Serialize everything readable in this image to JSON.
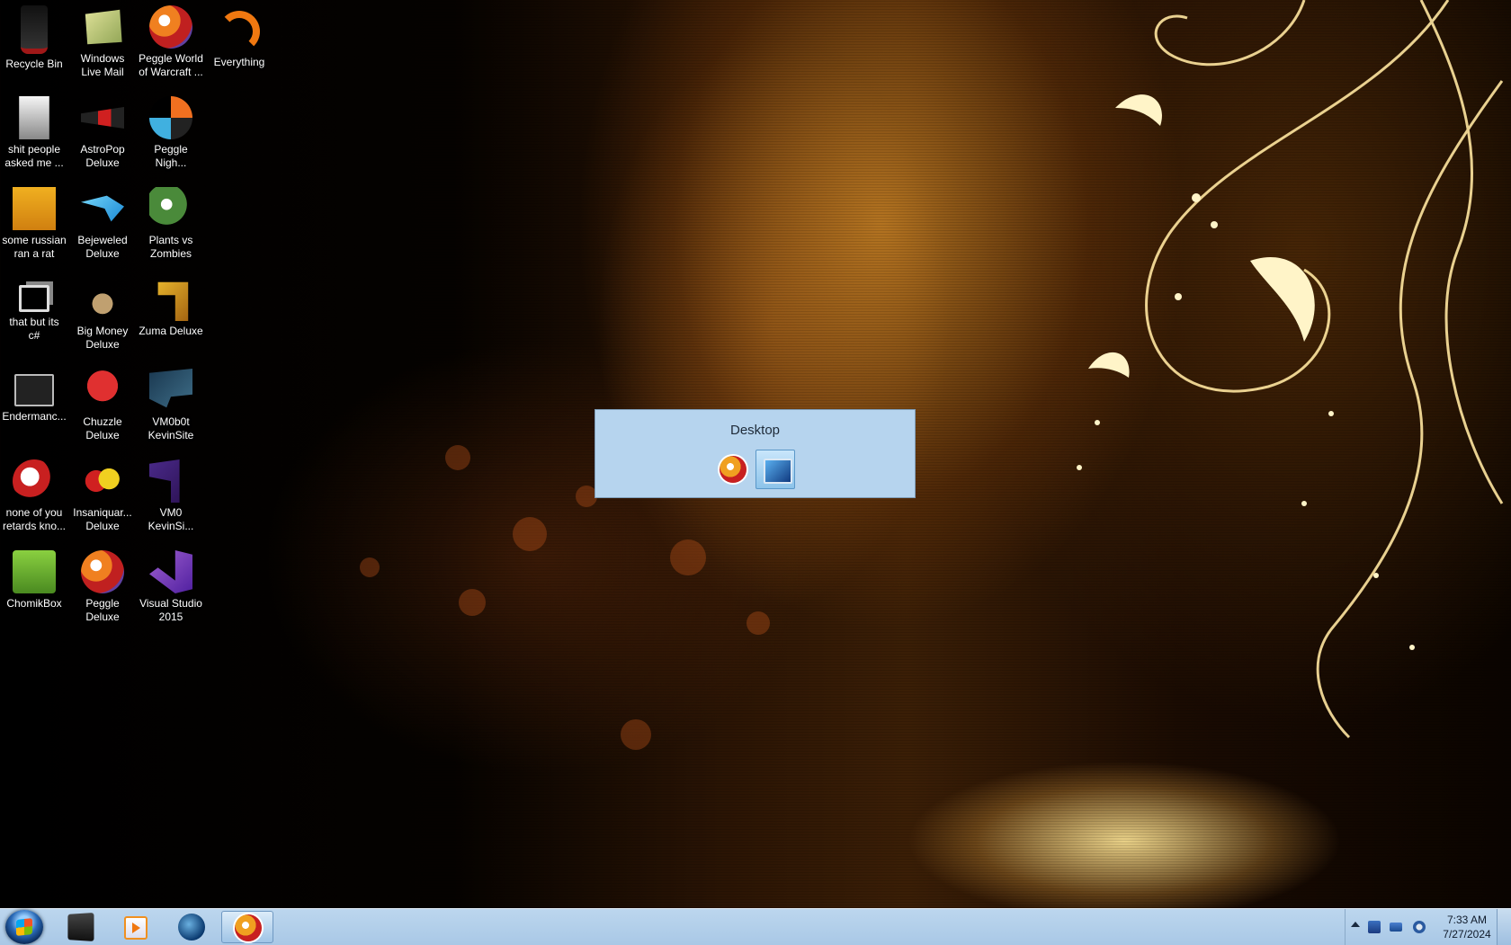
{
  "desktop": {
    "icons": [
      {
        "label": "Recycle Bin",
        "icon": "recycle-bin-icon"
      },
      {
        "label": "Windows\nLive Mail",
        "icon": "windows-live-mail-icon"
      },
      {
        "label": "Peggle World\nof Warcraft ...",
        "icon": "peggle-world-of-warcraft-icon"
      },
      {
        "label": "Everything",
        "icon": "everything-search-icon"
      },
      {
        "label": "shit people\nasked me ...",
        "icon": "text-document-icon"
      },
      {
        "label": "AstroPop\nDeluxe",
        "icon": "astropop-icon"
      },
      {
        "label": "Peggle\nNigh...",
        "icon": "peggle-nights-icon"
      },
      {
        "label": "some russian\nran a rat",
        "icon": "java-archive-icon"
      },
      {
        "label": "Bejeweled\nDeluxe",
        "icon": "bejeweled-icon"
      },
      {
        "label": "Plants vs\nZombies",
        "icon": "plants-vs-zombies-icon"
      },
      {
        "label": "that but its\nc#",
        "icon": "csharp-project-icon"
      },
      {
        "label": "Big Money\nDeluxe",
        "icon": "big-money-icon"
      },
      {
        "label": "Zuma Deluxe",
        "icon": "zuma-icon"
      },
      {
        "label": "Endermanc...",
        "icon": "console-app-icon"
      },
      {
        "label": "Chuzzle\nDeluxe",
        "icon": "chuzzle-icon"
      },
      {
        "label": "VM0b0t\nKevinSite",
        "icon": "vm-shortcut-icon"
      },
      {
        "label": "none of you\nretards kno...",
        "icon": "disc-icon"
      },
      {
        "label": "Insaniquar...\nDeluxe",
        "icon": "insaniquarium-icon"
      },
      {
        "label": "VM0\nKevinSi...",
        "icon": "vm-shortcut-icon"
      },
      {
        "label": "ChomikBox",
        "icon": "chomikbox-icon"
      },
      {
        "label": "Peggle\nDeluxe",
        "icon": "peggle-deluxe-icon"
      },
      {
        "label": "Visual Studio\n2015",
        "icon": "visual-studio-icon"
      }
    ]
  },
  "switcher": {
    "title": "Desktop",
    "items": [
      {
        "icon": "peggle-icon",
        "selected": false
      },
      {
        "icon": "desktop-icon",
        "selected": true
      }
    ]
  },
  "taskbar": {
    "start": "windows-start-orb-icon",
    "buttons": [
      {
        "icon": "command-prompt-icon",
        "active": false
      },
      {
        "icon": "media-player-icon",
        "active": false
      },
      {
        "icon": "globe-app-icon",
        "active": false
      },
      {
        "icon": "peggle-icon",
        "active": true
      }
    ],
    "tray": {
      "icons": [
        "network-icon",
        "display-icon",
        "volume-icon"
      ],
      "time": "7:33 AM",
      "date": "7/27/2024"
    }
  }
}
